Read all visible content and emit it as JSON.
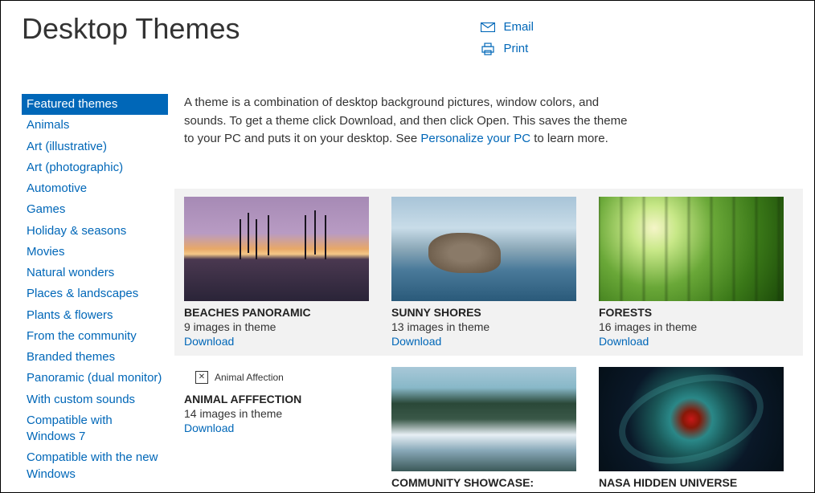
{
  "header": {
    "title": "Desktop Themes",
    "actions": {
      "email": "Email",
      "print": "Print"
    }
  },
  "sidebar": {
    "items": [
      {
        "label": "Featured themes",
        "selected": true
      },
      {
        "label": "Animals",
        "selected": false
      },
      {
        "label": "Art (illustrative)",
        "selected": false
      },
      {
        "label": "Art (photographic)",
        "selected": false
      },
      {
        "label": "Automotive",
        "selected": false
      },
      {
        "label": "Games",
        "selected": false
      },
      {
        "label": "Holiday & seasons",
        "selected": false
      },
      {
        "label": "Movies",
        "selected": false
      },
      {
        "label": "Natural wonders",
        "selected": false
      },
      {
        "label": "Places & landscapes",
        "selected": false
      },
      {
        "label": "Plants & flowers",
        "selected": false
      },
      {
        "label": "From the community",
        "selected": false
      },
      {
        "label": "Branded themes",
        "selected": false
      },
      {
        "label": "Panoramic (dual monitor)",
        "selected": false
      },
      {
        "label": "With custom sounds",
        "selected": false
      },
      {
        "label": "Compatible with Windows 7",
        "selected": false
      },
      {
        "label": "Compatible with the new Windows",
        "selected": false
      }
    ]
  },
  "intro": {
    "text_before": "A theme is a combination of desktop background pictures, window colors, and sounds. To get a theme click Download, and then click Open. This saves the theme to your PC and puts it on your desktop. See ",
    "link": "Personalize your PC",
    "text_after": " to learn more."
  },
  "themes": {
    "row1": [
      {
        "title": "BEACHES PANORAMIC",
        "sub": "9 images in theme",
        "download": "Download",
        "thumb": "beaches"
      },
      {
        "title": "SUNNY SHORES",
        "sub": "13 images in theme",
        "download": "Download",
        "thumb": "sunny"
      },
      {
        "title": "FORESTS",
        "sub": "16 images in theme",
        "download": "Download",
        "thumb": "forests"
      }
    ],
    "row2": [
      {
        "title": "ANIMAL AFFFECTION",
        "sub": "14 images in theme",
        "download": "Download",
        "placeholder": "Animal Affection"
      },
      {
        "title": "COMMUNITY SHOWCASE:",
        "sub": "",
        "download": "",
        "thumb": "community"
      },
      {
        "title": "NASA HIDDEN UNIVERSE",
        "sub": "",
        "download": "",
        "thumb": "nasa"
      }
    ]
  }
}
